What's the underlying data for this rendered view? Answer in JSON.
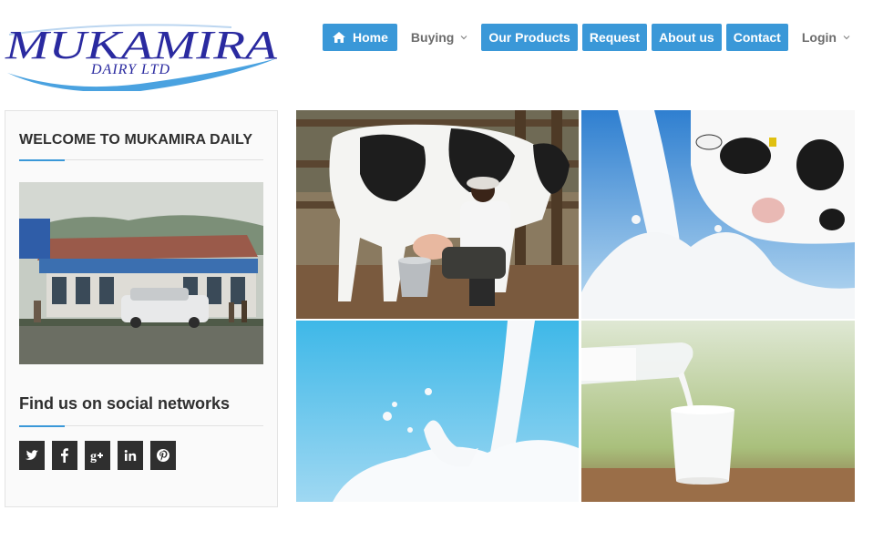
{
  "brand": {
    "logo_main": "MUKAMIRA",
    "logo_sub": "DAIRY LTD",
    "logo_color": "#2a2aa0",
    "swoosh_color": "#3a8fd8"
  },
  "nav": {
    "items": [
      {
        "label": "Home",
        "icon": "home-icon",
        "style": "blue"
      },
      {
        "label": "Buying",
        "icon": "chevron-down-icon",
        "style": "plain"
      },
      {
        "label": "Our Products",
        "style": "blue"
      },
      {
        "label": "Request",
        "style": "blue"
      },
      {
        "label": "About us",
        "style": "blue"
      },
      {
        "label": "Contact",
        "style": "blue"
      },
      {
        "label": "Login",
        "icon": "chevron-down-icon",
        "style": "plain"
      }
    ],
    "accent_color": "#3a98d8"
  },
  "sidebar": {
    "welcome_title": "WELCOME TO MUKAMIRA DAILY",
    "social_title": "Find us on social networks",
    "social_icons": [
      "twitter-icon",
      "facebook-icon",
      "google-plus-icon",
      "linkedin-icon",
      "pinterest-icon"
    ]
  },
  "gallery": {
    "tiles": [
      "man-milking-cow-photo",
      "cow-with-milk-splash-photo",
      "milk-pour-splash-photo",
      "milk-bottle-pouring-glass-photo"
    ]
  }
}
